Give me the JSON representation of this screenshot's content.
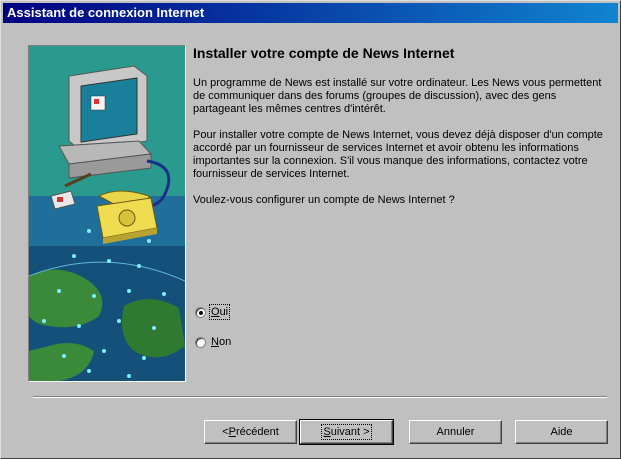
{
  "window": {
    "title": "Assistant de connexion Internet"
  },
  "main": {
    "heading": "Installer votre compte de News Internet",
    "paragraph1": "Un programme de News est installé sur votre ordinateur. Les News vous permettent de communiquer dans des forums (groupes de discussion), avec des gens partageant les mêmes centres d'intérêt.",
    "paragraph2": "Pour installer votre compte de News Internet, vous devez déjà disposer d'un compte accordé par un fournisseur de services Internet et avoir obtenu les informations importantes sur la connexion. S'il vous manque des informations, contactez votre fournisseur de services Internet.",
    "question": "Voulez-vous configurer un compte de News Internet ?"
  },
  "options": [
    {
      "accel": "O",
      "rest": "ui",
      "selected": true
    },
    {
      "accel": "N",
      "rest": "on",
      "selected": false
    }
  ],
  "buttons": {
    "previous": {
      "prefix": "< ",
      "accel": "P",
      "rest": "récédent"
    },
    "next": {
      "accel": "S",
      "rest": "uivant >"
    },
    "cancel": "Annuler",
    "help": "Aide"
  },
  "colors": {
    "title_start": "#000080",
    "title_end": "#1084d0",
    "face": "#c0c0c0",
    "illustration_teal": "#2a9a8e"
  },
  "icons": [
    "computer-icon",
    "telephone-icon",
    "globe-icon"
  ]
}
